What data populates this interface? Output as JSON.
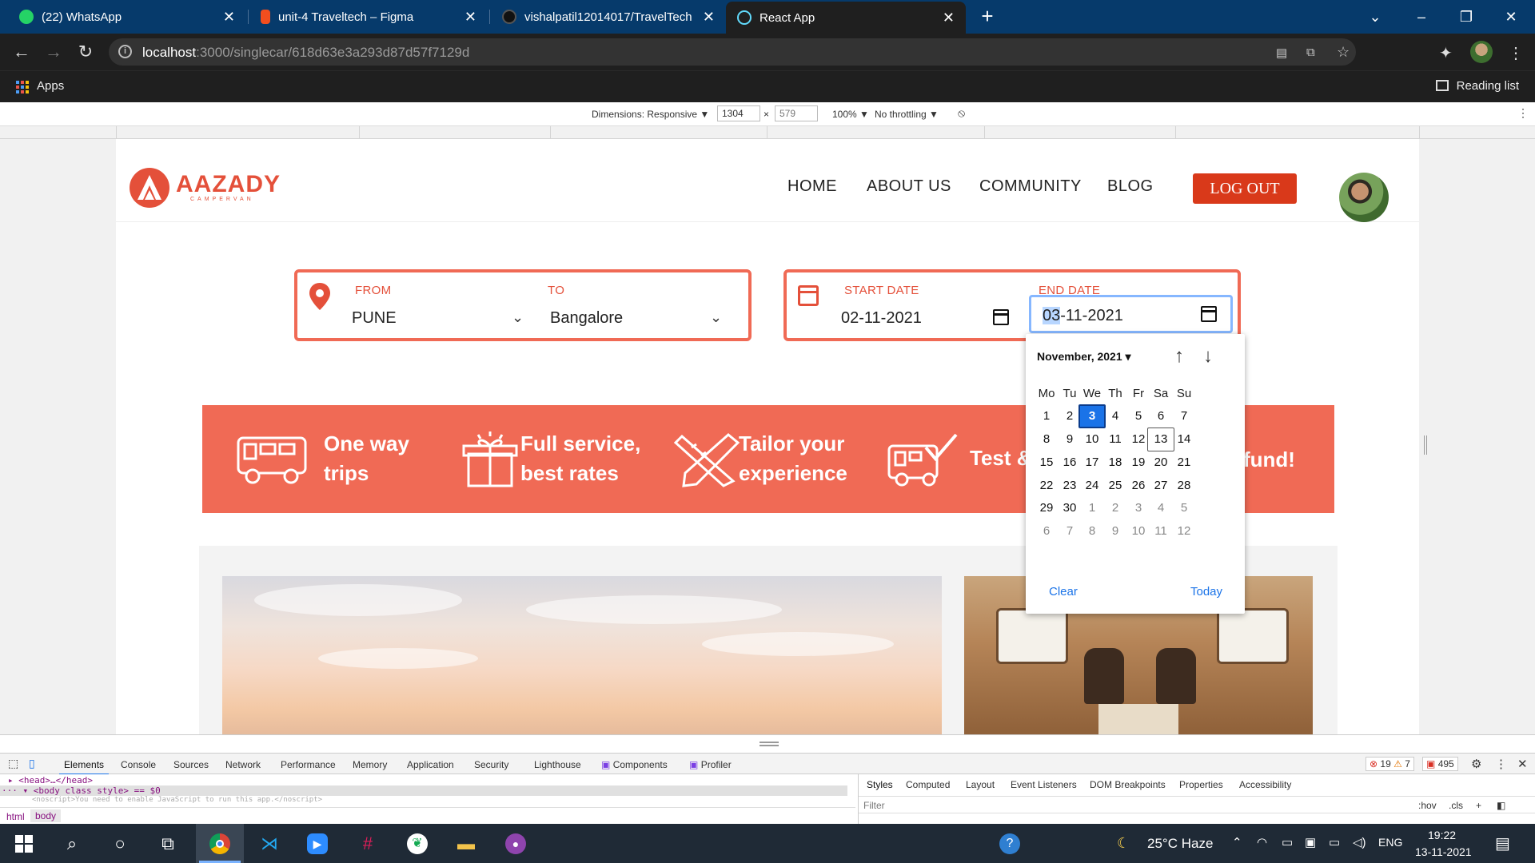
{
  "browser": {
    "tabs": [
      {
        "title": "(22) WhatsApp",
        "favicon": "whatsapp-icon",
        "color": "#25d366"
      },
      {
        "title": "unit-4 Traveltech – Figma",
        "favicon": "figma-icon",
        "color": "#f24e1e"
      },
      {
        "title": "vishalpatil12014017/TravelTech",
        "favicon": "github-icon",
        "color": "#222"
      },
      {
        "title": "React App",
        "favicon": "react-icon",
        "color": "#61dafb"
      }
    ],
    "url_host": "localhost",
    "url_path": ":3000/singlecar/618d63e3a293d87d57f7129d",
    "bookmarks": {
      "apps": "Apps",
      "reading_list": "Reading list"
    }
  },
  "devtools_toolbar": {
    "dimensions": "Dimensions: Responsive ▼",
    "width": "1304",
    "height": "579",
    "zoom": "100% ▼",
    "throttling": "No throttling ▼"
  },
  "page": {
    "logo": {
      "name": "AAZADY",
      "tagline": "CAMPERVAN"
    },
    "nav": [
      "HOME",
      "ABOUT US",
      "COMMUNITY",
      "BLOG"
    ],
    "logout": "LOG OUT",
    "route": {
      "from_label": "FROM",
      "from_value": "PUNE",
      "to_label": "TO",
      "to_value": "Bangalore"
    },
    "dates": {
      "start_label": "START DATE",
      "start_value": "02-11-2021",
      "end_label": "END DATE",
      "end_day": "03",
      "end_rest": "-11-2021"
    },
    "features": [
      {
        "line1": "One way",
        "line2": "trips",
        "icon": "campervan-icon"
      },
      {
        "line1": "Full service,",
        "line2": "best rates",
        "icon": "gift-box-icon"
      },
      {
        "line1": "Tailor your",
        "line2": "experience",
        "icon": "pencil-ruler-icon"
      },
      {
        "line1": "Test &",
        "line2": "",
        "icon": "van-check-icon"
      }
    ],
    "feature_partial": "fund!"
  },
  "datepicker": {
    "month": "November, 2021",
    "weekdays": [
      "Mo",
      "Tu",
      "We",
      "Th",
      "Fr",
      "Sa",
      "Su"
    ],
    "weeks": [
      [
        "1",
        "2",
        "3",
        "4",
        "5",
        "6",
        "7"
      ],
      [
        "8",
        "9",
        "10",
        "11",
        "12",
        "13",
        "14"
      ],
      [
        "15",
        "16",
        "17",
        "18",
        "19",
        "20",
        "21"
      ],
      [
        "22",
        "23",
        "24",
        "25",
        "26",
        "27",
        "28"
      ],
      [
        "29",
        "30",
        "1",
        "2",
        "3",
        "4",
        "5"
      ],
      [
        "6",
        "7",
        "8",
        "9",
        "10",
        "11",
        "12"
      ]
    ],
    "selected_day": "3",
    "today_day": "13",
    "clear": "Clear",
    "today": "Today"
  },
  "devtools": {
    "tabs": [
      "Elements",
      "Console",
      "Sources",
      "Network",
      "Performance",
      "Memory",
      "Application",
      "Security",
      "Lighthouse",
      "Components",
      "Profiler"
    ],
    "errors": "19",
    "warnings": "7",
    "issues": "495",
    "dom_line1": "<head>…</head>",
    "dom_line2": "<body class style> == $0",
    "dom_line3": "<noscript>You need to enable JavaScript to run this app.</noscript>",
    "crumbs": [
      "html",
      "body"
    ],
    "side_tabs": [
      "Styles",
      "Computed",
      "Layout",
      "Event Listeners",
      "DOM Breakpoints",
      "Properties",
      "Accessibility"
    ],
    "filter": "Filter",
    "hov": ":hov",
    "cls": ".cls"
  },
  "taskbar": {
    "weather": "25°C  Haze",
    "lang": "ENG",
    "time": "19:22",
    "date": "13-11-2021"
  }
}
